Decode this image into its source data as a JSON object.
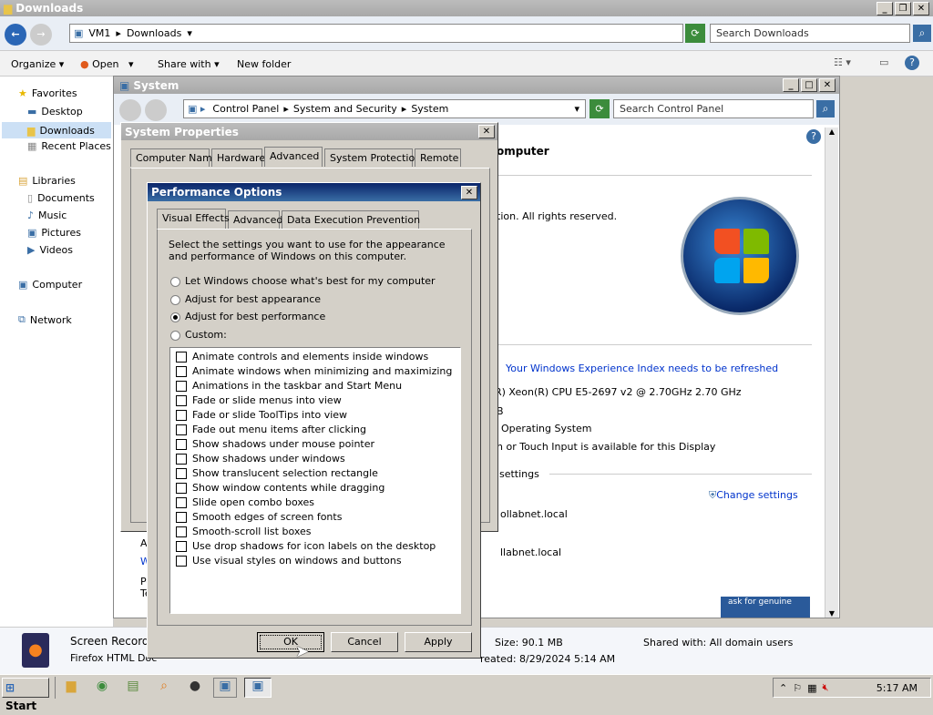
{
  "explorer": {
    "title": "Downloads",
    "address": [
      "VM1",
      "Downloads"
    ],
    "search_placeholder": "Search Downloads",
    "toolbar": {
      "organize": "Organize",
      "open": "Open",
      "share_with": "Share with",
      "new_folder": "New folder"
    },
    "nav": {
      "favorites": "Favorites",
      "desktop": "Desktop",
      "downloads": "Downloads",
      "recent_places": "Recent Places",
      "libraries": "Libraries",
      "documents": "Documents",
      "music": "Music",
      "pictures": "Pictures",
      "videos": "Videos",
      "computer": "Computer",
      "network": "Network"
    },
    "details": {
      "name": "Screen Recordin",
      "type": "Firefox HTML Doc",
      "size": "Size: 90.1 MB",
      "created": "reated: 8/29/2024 5:14 AM",
      "shared": "Shared with: All domain users"
    }
  },
  "system": {
    "title": "System",
    "address": [
      "Control Panel",
      "System and Security",
      "System"
    ],
    "search_placeholder": "Search Control Panel",
    "heading": "omputer",
    "rights": "tion.  All rights reserved.",
    "wei_link": "Your Windows Experience Index needs to be refreshed",
    "cpu": "R) Xeon(R) CPU E5-2697 v2 @ 2.70GHz   2.70 GHz",
    "ram": "B",
    "os_type": "Operating System",
    "pen": "n or Touch Input is available for this Display",
    "settings_header": "settings",
    "change_settings": "Change settings",
    "domain1": "ollabnet.local",
    "domain2": "llabnet.local",
    "genuine": "ask for genuine",
    "left_frag": [
      "A",
      "W",
      "Po",
      "Te"
    ]
  },
  "sysprops": {
    "title": "System Properties",
    "tabs": [
      "Computer Name",
      "Hardware",
      "Advanced",
      "System Protection",
      "Remote"
    ]
  },
  "perf": {
    "title": "Performance Options",
    "tabs": [
      "Visual Effects",
      "Advanced",
      "Data Execution Prevention"
    ],
    "desc": "Select the settings you want to use for the appearance and performance of Windows on this computer.",
    "radios": [
      "Let Windows choose what's best for my computer",
      "Adjust for best appearance",
      "Adjust for best performance",
      "Custom:"
    ],
    "selected_radio": 2,
    "checks": [
      "Animate controls and elements inside windows",
      "Animate windows when minimizing and maximizing",
      "Animations in the taskbar and Start Menu",
      "Fade or slide menus into view",
      "Fade or slide ToolTips into view",
      "Fade out menu items after clicking",
      "Show shadows under mouse pointer",
      "Show shadows under windows",
      "Show translucent selection rectangle",
      "Show window contents while dragging",
      "Slide open combo boxes",
      "Smooth edges of screen fonts",
      "Smooth-scroll list boxes",
      "Use drop shadows for icon labels on the desktop",
      "Use visual styles on windows and buttons"
    ],
    "ok": "OK",
    "cancel": "Cancel",
    "apply": "Apply"
  },
  "taskbar": {
    "start": "Start",
    "clock": "5:17 AM"
  },
  "colors": {
    "accent": "#0a246a",
    "link": "#0033cc",
    "titlebar_inactive": "#a8a8a8"
  }
}
